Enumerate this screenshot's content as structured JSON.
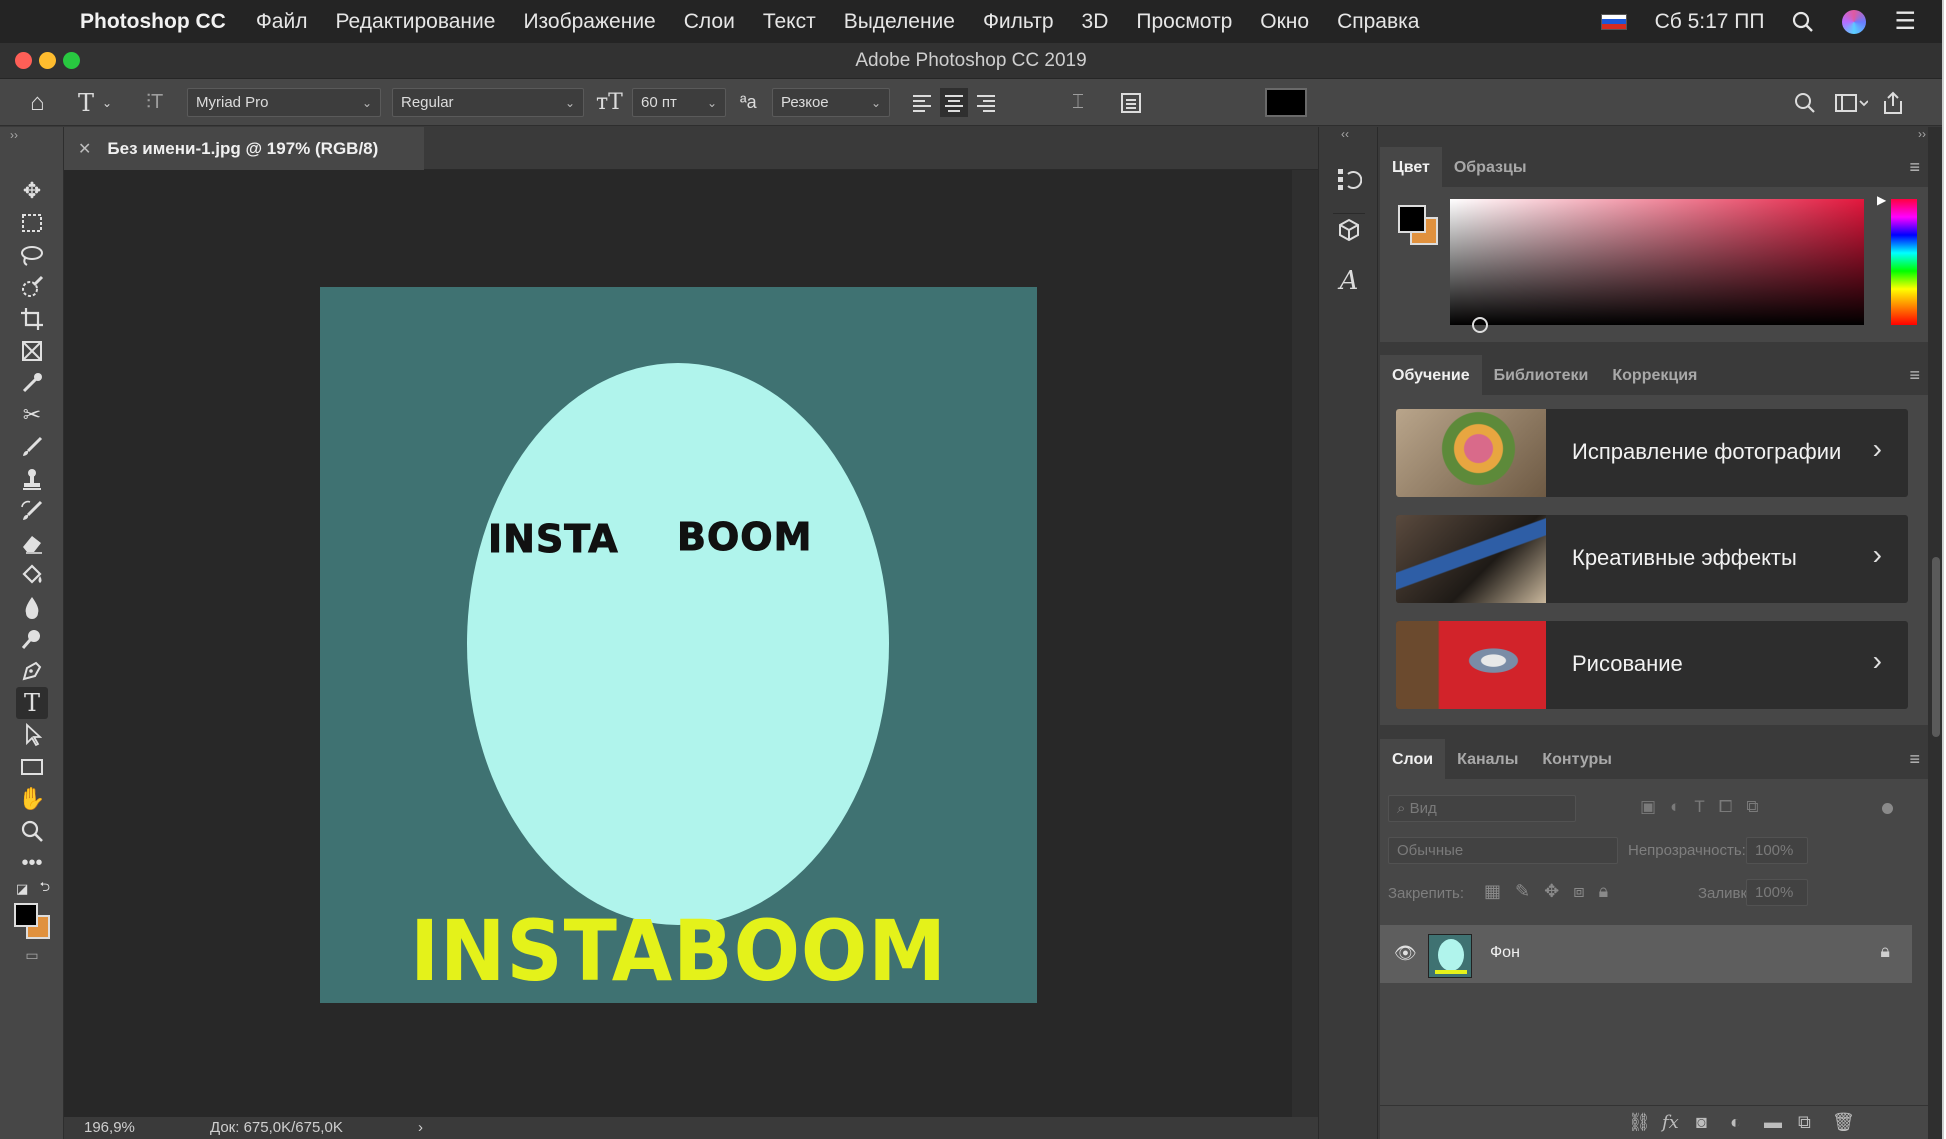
{
  "menubar": {
    "app_name": "Photoshop CC",
    "items": [
      "Файл",
      "Редактирование",
      "Изображение",
      "Слои",
      "Текст",
      "Выделение",
      "Фильтр",
      "3D",
      "Просмотр",
      "Окно",
      "Справка"
    ],
    "clock": "Сб 5:17 ПП"
  },
  "window": {
    "title": "Adobe Photoshop CC 2019",
    "traffic_colors": [
      "#fe5f57",
      "#febc2e",
      "#28c840"
    ]
  },
  "options": {
    "font_family": "Myriad Pro",
    "font_style": "Regular",
    "font_size": "60 пт",
    "aa_label": "ªa",
    "antialias": "Резкое",
    "text_color": "#000000"
  },
  "document": {
    "tab_title": "Без имени-1.jpg @ 197% (RGB/8)",
    "zoom": "196,9%",
    "doc_size": "Док: 675,0K/675,0K",
    "artwork": {
      "word_left": "INSTA",
      "word_right": "BOOM",
      "big_word": "INSTABOOM",
      "bg_color": "#3f7272",
      "egg_color": "#b0f4ec",
      "big_color": "#e4f21a"
    }
  },
  "panels": {
    "color_tabs": [
      "Цвет",
      "Образцы"
    ],
    "learn_tabs": [
      "Обучение",
      "Библиотеки",
      "Коррекция"
    ],
    "learn_cards": [
      "Исправление фотографии",
      "Креативные эффекты",
      "Рисование"
    ],
    "layers_tabs": [
      "Слои",
      "Каналы",
      "Контуры"
    ],
    "layers": {
      "filter_placeholder": "Вид",
      "blend_mode": "Обычные",
      "opacity_label": "Непрозрачность:",
      "opacity_value": "100%",
      "lock_label": "Закрепить:",
      "fill_label": "Заливка:",
      "fill_value": "100%",
      "items": [
        {
          "name": "Фон"
        }
      ]
    }
  }
}
